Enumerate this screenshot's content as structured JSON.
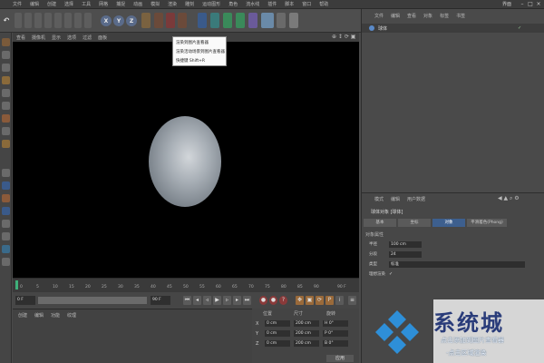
{
  "menubar": {
    "items": [
      "文件",
      "编辑",
      "创建",
      "选择",
      "工具",
      "网格",
      "捕捉",
      "动画",
      "模拟",
      "渲染",
      "雕刻",
      "运动图形",
      "角色",
      "流水线",
      "插件",
      "脚本",
      "窗口",
      "帮助"
    ],
    "layout_label": "界面"
  },
  "toolbar": {
    "axis_x": "X",
    "axis_y": "Y",
    "axis_z": "Z"
  },
  "tooltip": {
    "line1": "渲染到图片查看器",
    "line2": "渲染活动场景到图片查看器",
    "line3": "快捷键 Shift+R"
  },
  "viewport": {
    "menu": [
      "查看",
      "摄像机",
      "显示",
      "选项",
      "过滤",
      "面板"
    ]
  },
  "timeline": {
    "ticks": [
      "0",
      "5",
      "10",
      "15",
      "20",
      "25",
      "30",
      "35",
      "40",
      "45",
      "50",
      "55",
      "60",
      "65",
      "70",
      "75",
      "80",
      "85",
      "90"
    ],
    "end_frame": "90 F",
    "start_frame": "0 F",
    "max_frame": "90 F"
  },
  "bottom_left": {
    "menu": [
      "创建",
      "编辑",
      "功能",
      "纹理"
    ]
  },
  "coords": {
    "headers": [
      "位置",
      "尺寸",
      "旋转"
    ],
    "rows": [
      {
        "axis": "X",
        "pos": "0 cm",
        "size": "200 cm",
        "rot": "H 0°"
      },
      {
        "axis": "Y",
        "pos": "0 cm",
        "size": "200 cm",
        "rot": "P 0°"
      },
      {
        "axis": "Z",
        "pos": "0 cm",
        "size": "200 cm",
        "rot": "B 0°"
      }
    ],
    "apply": "应用"
  },
  "object_panel": {
    "menu": [
      "文件",
      "编辑",
      "查看",
      "对象",
      "标签",
      "书签"
    ],
    "object_name": "球体"
  },
  "attr_panel": {
    "menu": [
      "模式",
      "编辑",
      "用户数据"
    ],
    "title": "球体对象 [球体]",
    "tabs": [
      "基本",
      "坐标",
      "对象",
      "平滑着色(Phong)"
    ],
    "section": "对象属性",
    "fields": [
      {
        "label": "半径",
        "value": "100 cm"
      },
      {
        "label": "分段",
        "value": "24"
      },
      {
        "label": "类型",
        "value": "标准"
      },
      {
        "label": "理想渲染",
        "value": "✓"
      }
    ]
  },
  "watermark": {
    "brand": "系统城",
    "line1": "点击添加到图片查看器",
    "line2": "-点击区域渲染"
  },
  "colors": {
    "accent": "#3d5f8e",
    "brand": "#2a3c7a"
  }
}
